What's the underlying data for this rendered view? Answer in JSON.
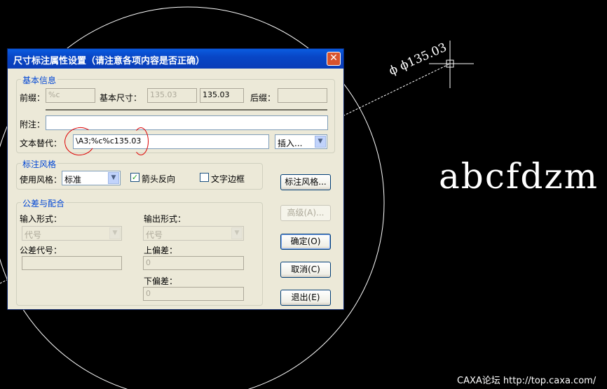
{
  "cad": {
    "big_text": "abcfdzm",
    "dim_text": "ϕ ϕ135.03",
    "watermark": "CAXA论坛 http://top.caxa.com/"
  },
  "dialog": {
    "title": "尺寸标注属性设置（请注意各项内容是否正确）",
    "close_label": "✕",
    "basic": {
      "legend": "基本信息",
      "prefix_label": "前缀：",
      "prefix_value": "%c",
      "base_size_label": "基本尺寸：",
      "base_size_value": "135.03",
      "base_size_readonly": "135.03",
      "suffix_label": "后缀：",
      "suffix_value": "",
      "note_label": "附注：",
      "note_value": "",
      "text_replace_label": "文本替代：",
      "text_replace_value": "\\A3;%c%c135.03",
      "insert_value": "插入..."
    },
    "style": {
      "legend": "标注风格",
      "use_style_label": "使用风格：",
      "use_style_value": "标准",
      "arrow_reverse_label": "箭头反向",
      "arrow_reverse_checked": "✓",
      "text_border_label": "文字边框",
      "style_button": "标注风格..."
    },
    "tolerance": {
      "legend": "公差与配合",
      "input_form_label": "输入形式：",
      "input_form_value": "代号",
      "output_form_label": "输出形式：",
      "output_form_value": "代号",
      "tolerance_code_label": "公差代号：",
      "tolerance_code_value": "",
      "upper_dev_label": "上偏差：",
      "upper_dev_value": "0",
      "lower_dev_label": "下偏差：",
      "lower_dev_value": "0"
    },
    "buttons": {
      "advanced": "高级(A)...",
      "ok": "确定(O)",
      "cancel": "取消(C)",
      "exit": "退出(E)"
    }
  }
}
